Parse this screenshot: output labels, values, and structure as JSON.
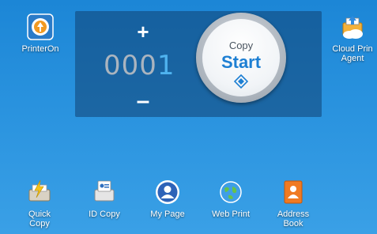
{
  "apps": {
    "printeron": {
      "label": "PrinterOn",
      "icon": "printeron-icon"
    },
    "cloud_print": {
      "label_line1": "Cloud Prin",
      "label_line2": "Agent",
      "icon": "cloud-print-icon"
    }
  },
  "copy_panel": {
    "plus": "+",
    "minus": "–",
    "count_digits": [
      "0",
      "0",
      "0",
      "1"
    ],
    "start_top": "Copy",
    "start_main": "Start"
  },
  "dock": [
    {
      "label_line1": "Quick",
      "label_line2": "Copy",
      "icon": "quick-copy-icon"
    },
    {
      "label_line1": "ID Copy",
      "label_line2": "",
      "icon": "id-copy-icon"
    },
    {
      "label_line1": "My Page",
      "label_line2": "",
      "icon": "my-page-icon"
    },
    {
      "label_line1": "Web Print",
      "label_line2": "",
      "icon": "web-print-icon"
    },
    {
      "label_line1": "Address",
      "label_line2": "Book",
      "icon": "address-book-icon"
    }
  ],
  "colors": {
    "accent": "#1d7fd3",
    "background": "#2c95e0"
  }
}
